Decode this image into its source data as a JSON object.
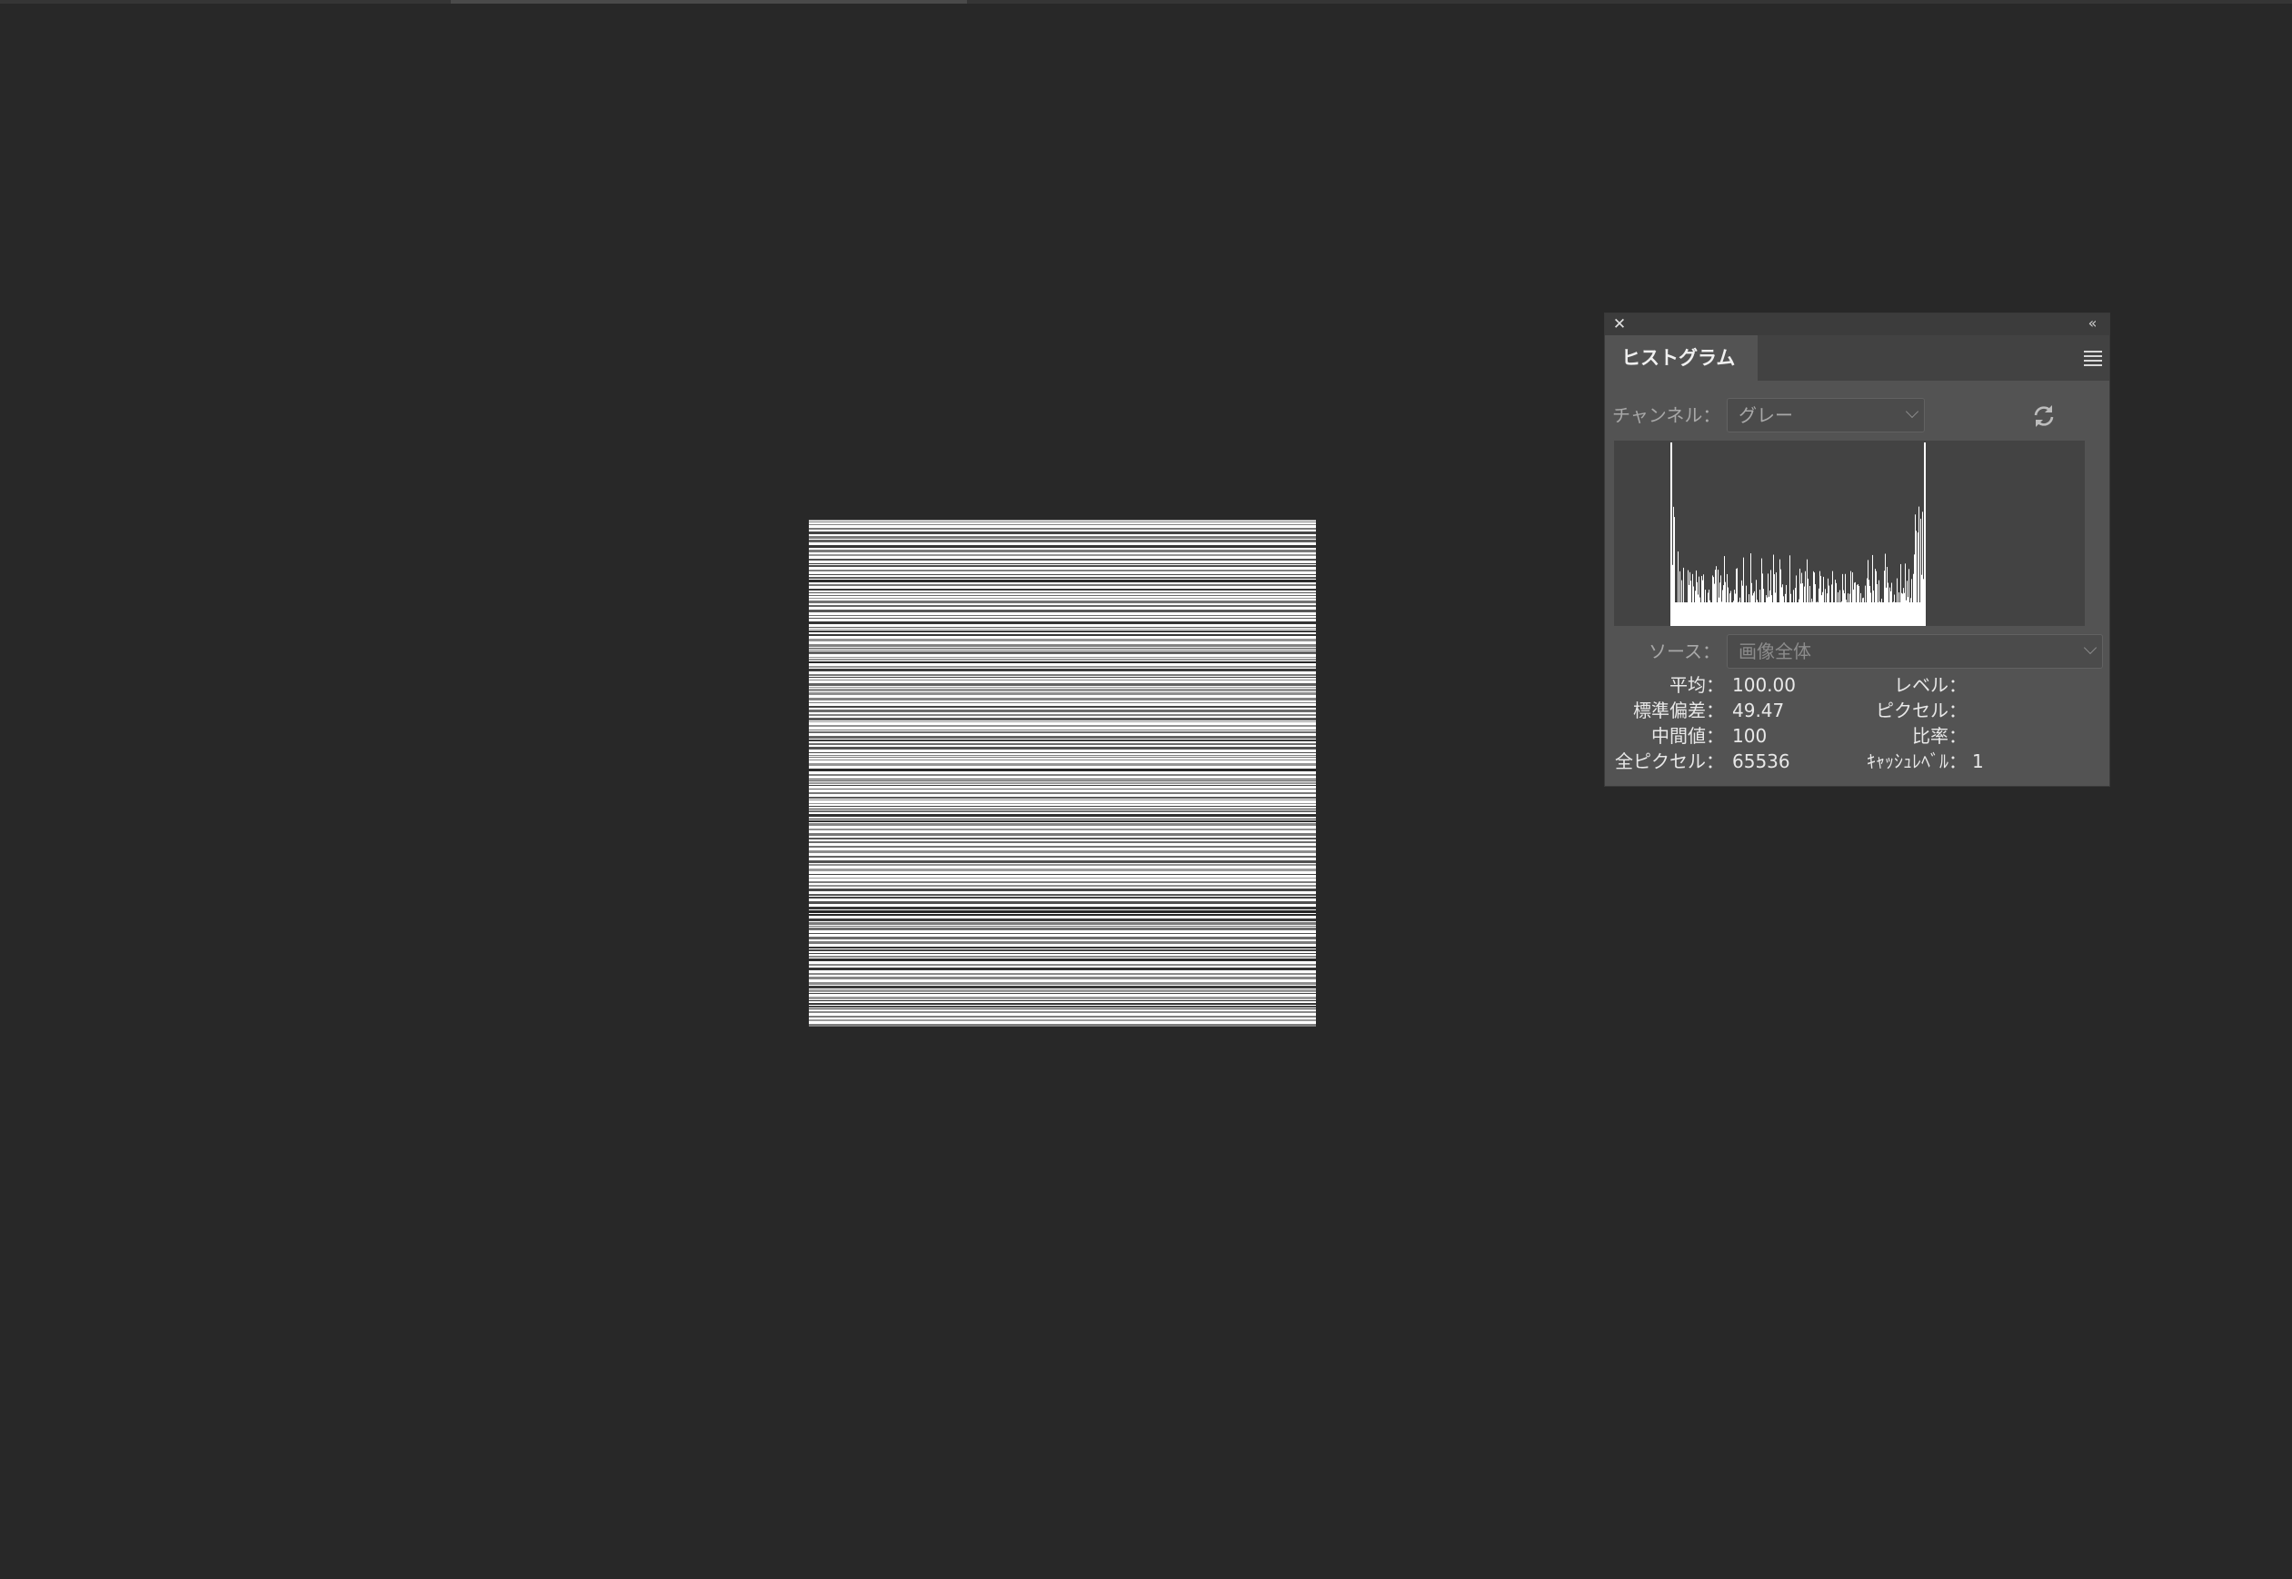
{
  "panel": {
    "tab_label": "ヒストグラム",
    "channel_label": "チャンネル：",
    "channel_value": "グレー",
    "source_label": "ソース：",
    "source_value": "画像全体"
  },
  "stats_left": [
    {
      "label": "平均：",
      "value": "100.00"
    },
    {
      "label": "標準偏差：",
      "value": "49.47"
    },
    {
      "label": "中間値：",
      "value": "100"
    },
    {
      "label": "全ピクセル：",
      "value": "65536"
    }
  ],
  "stats_right": [
    {
      "label": "レベル：",
      "value": ""
    },
    {
      "label": "ピクセル：",
      "value": ""
    },
    {
      "label": "比率：",
      "value": ""
    },
    {
      "label": "ｷｬｯｼｭﾚﾍﾞﾙ：",
      "value": "1"
    }
  ],
  "icons": {
    "close": "close-icon",
    "collapse": "double-chevron-left-icon",
    "menu": "hamburger-menu-icon",
    "refresh": "refresh-icon"
  },
  "colors": {
    "workspace_bg": "#282828",
    "panel_bg": "#535353",
    "graph_bg": "#434343",
    "histogram_fill": "#ffffff"
  }
}
